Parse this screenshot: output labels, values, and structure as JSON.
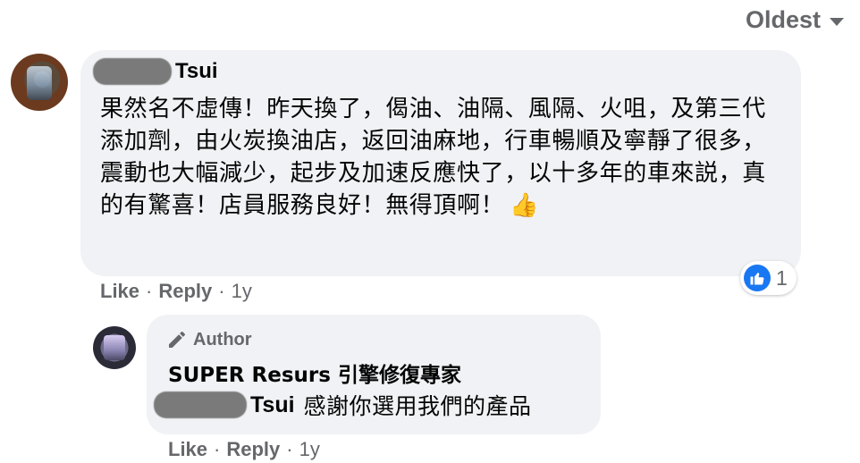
{
  "sort": {
    "label": "Oldest"
  },
  "comment": {
    "author_suffix": "Tsui",
    "text": "果然名不虛傳！昨天換了，偈油、油隔、風隔、火咀，及第三代添加劑，由火炭換油店，返回油麻地，行車暢順及寧靜了很多，震動也大幅減少，起步及加速反應快了，以十多年的車來説，真的有驚喜！店員服務良好！無得頂啊！",
    "emoji": "thumbs-up-icon",
    "reaction_count": "1",
    "actions": {
      "like": "Like",
      "reply": "Reply",
      "time": "1y",
      "separator": "·"
    }
  },
  "reply": {
    "badge": "Author",
    "author": "SUPER Resurs 引擎修復專家",
    "mention_suffix": "Tsui",
    "text": "感謝你選用我們的產品",
    "actions": {
      "like": "Like",
      "reply": "Reply",
      "time": "1y",
      "separator": "·"
    }
  },
  "colors": {
    "bubble": "#f0f2f5",
    "secondary_text": "#65676b",
    "primary_text": "#050505",
    "like_blue": "#1877f2"
  }
}
